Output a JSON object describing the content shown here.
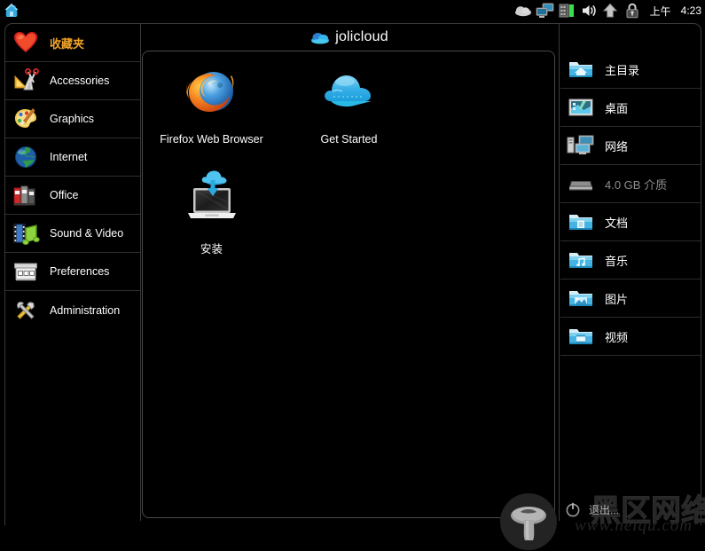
{
  "topbar": {
    "home_icon": "home-icon",
    "tray_icons": [
      {
        "name": "cloud-status-icon"
      },
      {
        "name": "network-monitor-icon"
      },
      {
        "name": "memory-icon"
      },
      {
        "name": "volume-icon"
      },
      {
        "name": "update-arrow-icon"
      },
      {
        "name": "lock-icon"
      }
    ],
    "clock_ampm": "上午",
    "clock_time": "4:23"
  },
  "brand": {
    "name": "jolicloud",
    "logo_icon": "cloud-logo-icon"
  },
  "categories": [
    {
      "label": "收藏夹",
      "icon": "heart-icon",
      "favorite": true
    },
    {
      "label": "Accessories",
      "icon": "accessories-icon",
      "favorite": false
    },
    {
      "label": "Graphics",
      "icon": "palette-icon",
      "favorite": false
    },
    {
      "label": "Internet",
      "icon": "globe-icon",
      "favorite": false
    },
    {
      "label": "Office",
      "icon": "binders-icon",
      "favorite": false
    },
    {
      "label": "Sound & Video",
      "icon": "multimedia-icon",
      "favorite": false
    },
    {
      "label": "Preferences",
      "icon": "preferences-icon",
      "favorite": false
    },
    {
      "label": "Administration",
      "icon": "tools-icon",
      "favorite": false
    }
  ],
  "apps": [
    {
      "label": "Firefox Web Browser",
      "icon": "firefox-icon"
    },
    {
      "label": "Get Started",
      "icon": "cloud-icon"
    },
    {
      "label": "安装",
      "icon": "install-laptop-icon"
    }
  ],
  "places": [
    {
      "label": "主目录",
      "icon": "home-folder-icon",
      "dim": false
    },
    {
      "label": "桌面",
      "icon": "desktop-icon",
      "dim": false
    },
    {
      "label": "网络",
      "icon": "network-icon",
      "dim": false
    },
    {
      "label": "4.0 GB 介质",
      "icon": "drive-icon",
      "dim": true
    },
    {
      "label": "文档",
      "icon": "documents-folder-icon",
      "dim": false
    },
    {
      "label": "音乐",
      "icon": "music-folder-icon",
      "dim": false
    },
    {
      "label": "图片",
      "icon": "pictures-folder-icon",
      "dim": false
    },
    {
      "label": "视频",
      "icon": "videos-folder-icon",
      "dim": false
    }
  ],
  "logout": {
    "label": "退出...",
    "icon": "power-icon"
  },
  "watermark": {
    "cn_text": "黑区网络",
    "url_text": "www.heiqu.com",
    "logo_icon": "mushroom-icon"
  },
  "colors": {
    "background": "#000000",
    "text": "#ffffff",
    "favorite_text": "#f0a32a",
    "dim_text": "#8d8d8d",
    "border": "#3a3a3a",
    "accent_blue": "#39b7e8"
  }
}
